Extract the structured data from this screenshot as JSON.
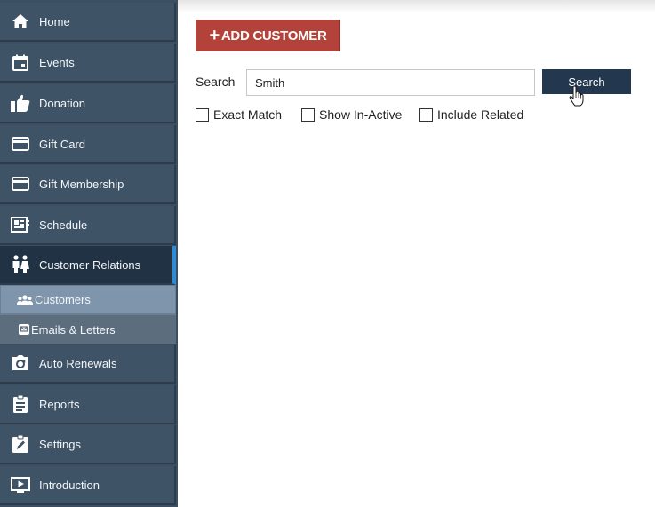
{
  "sidebar": {
    "items": [
      {
        "label": "Home",
        "icon": "home-icon"
      },
      {
        "label": "Events",
        "icon": "calendar-icon"
      },
      {
        "label": "Donation",
        "icon": "thumbs-up-icon"
      },
      {
        "label": "Gift Card",
        "icon": "card-icon"
      },
      {
        "label": "Gift Membership",
        "icon": "card-icon"
      },
      {
        "label": "Schedule",
        "icon": "schedule-icon"
      },
      {
        "label": "Customer Relations",
        "icon": "people-icon",
        "active": true
      },
      {
        "label": "Auto Renewals",
        "icon": "camera-renew-icon"
      },
      {
        "label": "Reports",
        "icon": "clipboard-icon"
      },
      {
        "label": "Settings",
        "icon": "settings-edit-icon"
      },
      {
        "label": "Introduction",
        "icon": "play-icon"
      }
    ],
    "sub_items": [
      {
        "label": "Customers",
        "icon": "users-icon",
        "active": true
      },
      {
        "label": "Emails & Letters",
        "icon": "mail-icon"
      }
    ],
    "active_accent": "#2e8bd6"
  },
  "main": {
    "add_customer_label": "ADD CUSTOMER",
    "search_label": "Search",
    "search_value": "Smith",
    "search_button_label": "Search",
    "checkboxes": [
      {
        "label": "Exact Match",
        "checked": false
      },
      {
        "label": "Show In-Active",
        "checked": false
      },
      {
        "label": "Include Related",
        "checked": false
      }
    ]
  },
  "colors": {
    "sidebar_bg": "#3f5366",
    "add_button": "#b3423a",
    "search_button": "#23384f"
  }
}
